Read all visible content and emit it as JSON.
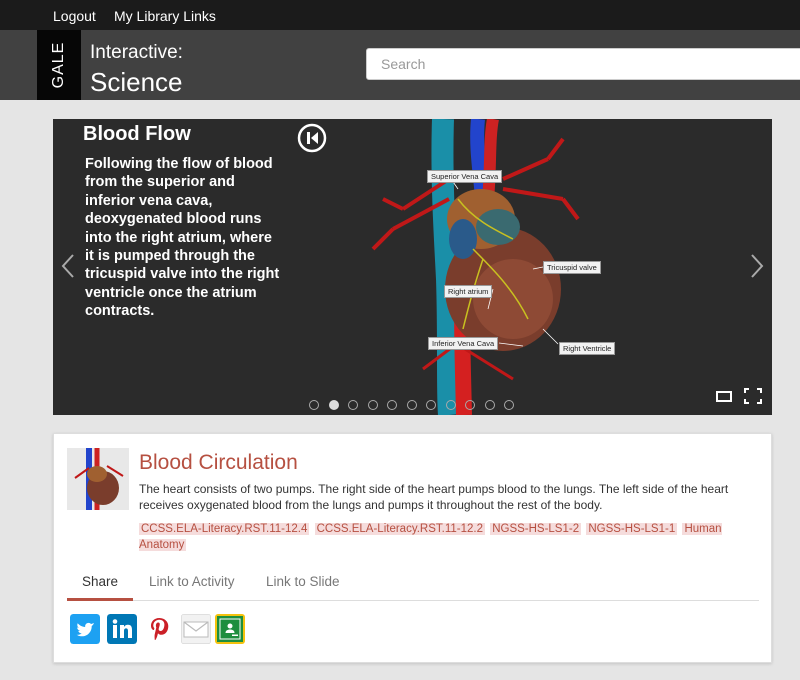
{
  "topbar": {
    "logout": "Logout",
    "library_links": "My Library Links"
  },
  "header": {
    "logo_text": "GALE",
    "title_line1": "Interactive:",
    "title_line2": "Science",
    "search_placeholder": "Search"
  },
  "slider": {
    "title": "Blood Flow",
    "text": "Following the flow of blood from the superior and inferior  vena cava, deoxygenated blood runs into the right atrium, where it is pumped through the tricuspid valve into the right ventricle once the atrium contracts.",
    "callouts": {
      "svc": "Superior Vena Cava",
      "tricuspid": "Tricuspid valve",
      "atrium": "Right atrium",
      "ivc": "Inferior Vena Cava",
      "ventricle": "Right Ventricle"
    },
    "dot_count": 11,
    "active_dot": 2
  },
  "card": {
    "title": "Blood Circulation",
    "description": "The heart consists of two pumps. The right side of the heart pumps blood to the lungs. The left side of the heart receives oxygenated blood from the lungs and pumps it throughout the rest of the body.",
    "tags": [
      "CCSS.ELA-Literacy.RST.11-12.4",
      "CCSS.ELA-Literacy.RST.11-12.2",
      "NGSS-HS-LS1-2",
      "NGSS-HS-LS1-1",
      "Human Anatomy"
    ],
    "tabs": [
      "Share",
      "Link to Activity",
      "Link to Slide"
    ],
    "active_tab": "Share",
    "share_icons": [
      "twitter-icon",
      "linkedin-icon",
      "pinterest-icon",
      "email-icon",
      "google-classroom-icon"
    ]
  },
  "colors": {
    "accent": "#b65041",
    "twitter": "#1da1f2",
    "linkedin": "#0077b5",
    "pinterest": "#cb2027",
    "classroom": "#1e8e3e"
  }
}
